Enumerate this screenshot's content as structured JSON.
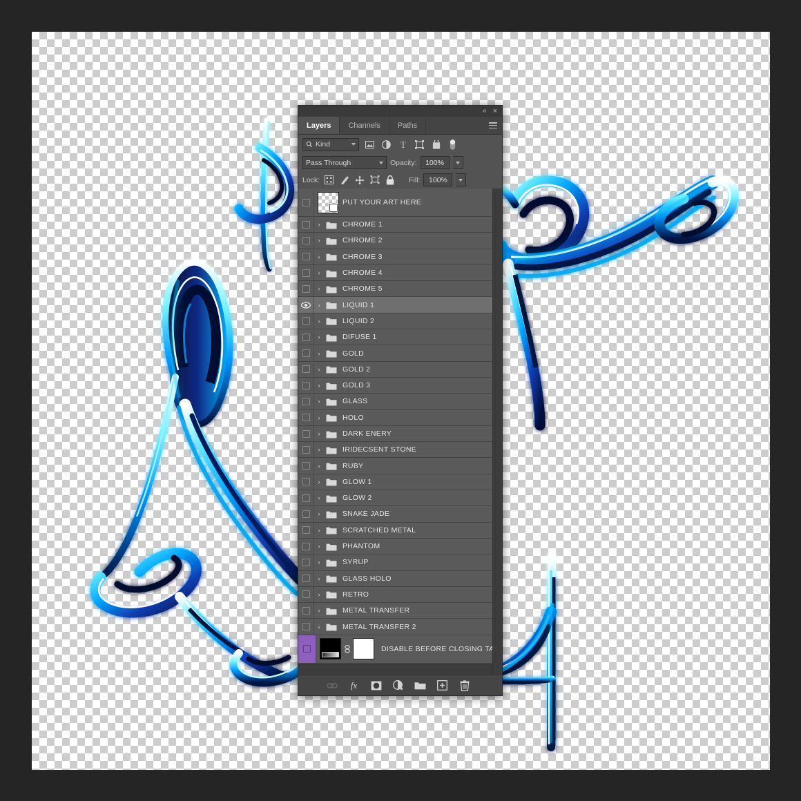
{
  "panel": {
    "collapse_label": "«",
    "close_label": "×",
    "tabs": [
      {
        "label": "Layers",
        "active": true
      },
      {
        "label": "Channels",
        "active": false
      },
      {
        "label": "Paths",
        "active": false
      }
    ],
    "menu_icon": "hamburger-menu-icon"
  },
  "filter": {
    "search_icon": "search-icon",
    "kind_label": "Kind",
    "buttons": [
      {
        "icon": "pixel-layer-filter-icon"
      },
      {
        "icon": "adjustment-layer-filter-icon"
      },
      {
        "icon": "type-layer-filter-icon"
      },
      {
        "icon": "shape-layer-filter-icon"
      },
      {
        "icon": "smart-object-filter-icon"
      }
    ],
    "toggle_icon": "filter-toggle-switch"
  },
  "options": {
    "blend_mode": "Pass Through",
    "opacity_label": "Opacity:",
    "opacity_value": "100%",
    "lock_label": "Lock:",
    "fill_label": "Fill:",
    "fill_value": "100%",
    "lock_buttons": [
      {
        "icon": "lock-transparent-pixels-icon"
      },
      {
        "icon": "lock-image-pixels-icon"
      },
      {
        "icon": "lock-position-icon"
      },
      {
        "icon": "lock-artboard-nesting-icon"
      },
      {
        "icon": "lock-all-icon"
      }
    ]
  },
  "layers": [
    {
      "name": "PUT YOUR ART HERE",
      "type": "smart-object",
      "visible": false,
      "selected": false,
      "expandable": false
    },
    {
      "name": "CHROME 1",
      "type": "group",
      "visible": false,
      "selected": false,
      "expandable": true
    },
    {
      "name": "CHROME 2",
      "type": "group",
      "visible": false,
      "selected": false,
      "expandable": true
    },
    {
      "name": "CHROME 3",
      "type": "group",
      "visible": false,
      "selected": false,
      "expandable": true
    },
    {
      "name": "CHROME 4",
      "type": "group",
      "visible": false,
      "selected": false,
      "expandable": true
    },
    {
      "name": "CHROME 5",
      "type": "group",
      "visible": false,
      "selected": false,
      "expandable": true
    },
    {
      "name": "LIQUID 1",
      "type": "group",
      "visible": true,
      "selected": true,
      "expandable": true
    },
    {
      "name": "LIQUID 2",
      "type": "group",
      "visible": false,
      "selected": false,
      "expandable": true
    },
    {
      "name": "DIFUSE 1",
      "type": "group",
      "visible": false,
      "selected": false,
      "expandable": true
    },
    {
      "name": "GOLD",
      "type": "group",
      "visible": false,
      "selected": false,
      "expandable": true
    },
    {
      "name": "GOLD 2",
      "type": "group",
      "visible": false,
      "selected": false,
      "expandable": true
    },
    {
      "name": "GOLD 3",
      "type": "group",
      "visible": false,
      "selected": false,
      "expandable": true
    },
    {
      "name": "GLASS",
      "type": "group",
      "visible": false,
      "selected": false,
      "expandable": true
    },
    {
      "name": "HOLO",
      "type": "group",
      "visible": false,
      "selected": false,
      "expandable": true
    },
    {
      "name": "DARK ENERY",
      "type": "group",
      "visible": false,
      "selected": false,
      "expandable": true
    },
    {
      "name": "IRIDECSENT STONE",
      "type": "group",
      "visible": false,
      "selected": false,
      "expandable": true
    },
    {
      "name": "RUBY",
      "type": "group",
      "visible": false,
      "selected": false,
      "expandable": true
    },
    {
      "name": "GLOW 1",
      "type": "group",
      "visible": false,
      "selected": false,
      "expandable": true
    },
    {
      "name": "GLOW 2",
      "type": "group",
      "visible": false,
      "selected": false,
      "expandable": true
    },
    {
      "name": "SNAKE JADE",
      "type": "group",
      "visible": false,
      "selected": false,
      "expandable": true
    },
    {
      "name": "SCRATCHED METAL",
      "type": "group",
      "visible": false,
      "selected": false,
      "expandable": true
    },
    {
      "name": "PHANTOM",
      "type": "group",
      "visible": false,
      "selected": false,
      "expandable": true
    },
    {
      "name": "SYRUP",
      "type": "group",
      "visible": false,
      "selected": false,
      "expandable": true
    },
    {
      "name": "GLASS HOLO",
      "type": "group",
      "visible": false,
      "selected": false,
      "expandable": true
    },
    {
      "name": "RETRO",
      "type": "group",
      "visible": false,
      "selected": false,
      "expandable": true
    },
    {
      "name": "METAL TRANSFER",
      "type": "group",
      "visible": false,
      "selected": false,
      "expandable": true
    },
    {
      "name": "METAL TRANSFER 2",
      "type": "group",
      "visible": false,
      "selected": false,
      "expandable": true
    },
    {
      "name": "DISABLE BEFORE CLOSING TAB",
      "type": "masked-layer",
      "visible": false,
      "selected": false,
      "expandable": false,
      "color_label": "#8f5fbe"
    }
  ],
  "footer": {
    "buttons": [
      {
        "icon": "link-layers-icon",
        "label": "",
        "disabled": true
      },
      {
        "icon": "layer-style-fx-icon",
        "label": "fx",
        "disabled": false
      },
      {
        "icon": "add-layer-mask-icon",
        "label": "",
        "disabled": false
      },
      {
        "icon": "new-adjustment-layer-icon",
        "label": "",
        "disabled": false
      },
      {
        "icon": "new-group-icon",
        "label": "",
        "disabled": false
      },
      {
        "icon": "new-layer-icon",
        "label": "",
        "disabled": false
      },
      {
        "icon": "delete-layer-icon",
        "label": "",
        "disabled": false
      }
    ]
  },
  "colors": {
    "app_background": "#252525",
    "panel_background": "#535353",
    "row_background": "#5a5a5a",
    "row_selected": "#6f6f6f",
    "artwork_cyan": "#00c4ff",
    "artwork_blue": "#0a52d6",
    "artwork_dark": "#050a30",
    "color_label_purple": "#8f5fbe"
  }
}
